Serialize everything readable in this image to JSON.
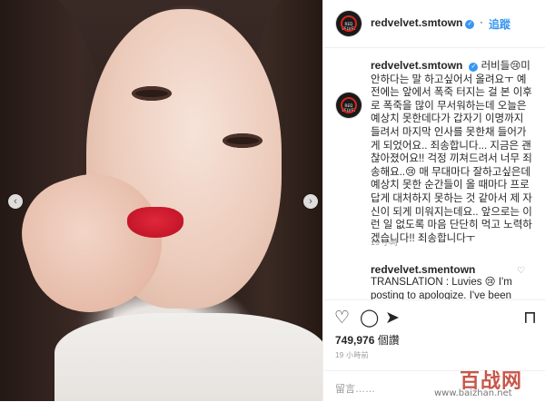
{
  "post": {
    "username": "redvelvet.smtown",
    "verified_glyph": "✓",
    "follow_label": "追蹤",
    "avatar_text": "RED VELVET",
    "caption": "러비들😢미안하다는 말 하고싶어서 올려요ㅜ 예전에는 앞에서 폭죽 터지는 걸 본 이후로 폭죽을 많이 무서워하는데 오늘은 예상치 못한데다가 갑자기 이명까지 들려서 마지막 인사를 못한채 들어가게 되었어요.. 죄송합니다... 지금은 괜찮아졌어요!! 걱정 끼쳐드려서 너무 죄송해요..😢 매 무대마다 잘하고싶은데 예상치 못한 순간들이 올 때마다 프로답게 대처하지 못하는 것 같아서 제 자신이 되게 미워지는데요.. 앞으로는 이런 일 없도록 마음 단단히 먹고 노력하겠습니다!! 죄송합니다ㅜ",
    "caption_time": "19 小時",
    "comment2_user": "redvelvet.smentown",
    "comment2_text": "TRANSLATION : Luvies 😢 I'm posting to apologize. I've been scared of fireworks after I",
    "likes_count": "749,976",
    "likes_label": " 個讚",
    "date": "19 小時前",
    "comment_placeholder": "留言……"
  },
  "icons": {
    "heart": "♡",
    "comment": "◯",
    "share": "➤",
    "save": "⊓",
    "nav_left": "‹",
    "nav_right": "›",
    "more": "·"
  },
  "watermark": {
    "logo": "百战网",
    "url": "www.baizhan.net"
  },
  "colors": {
    "link": "#3897f0",
    "lips": "#d01f30",
    "avatar_ring": "#d9261c"
  }
}
